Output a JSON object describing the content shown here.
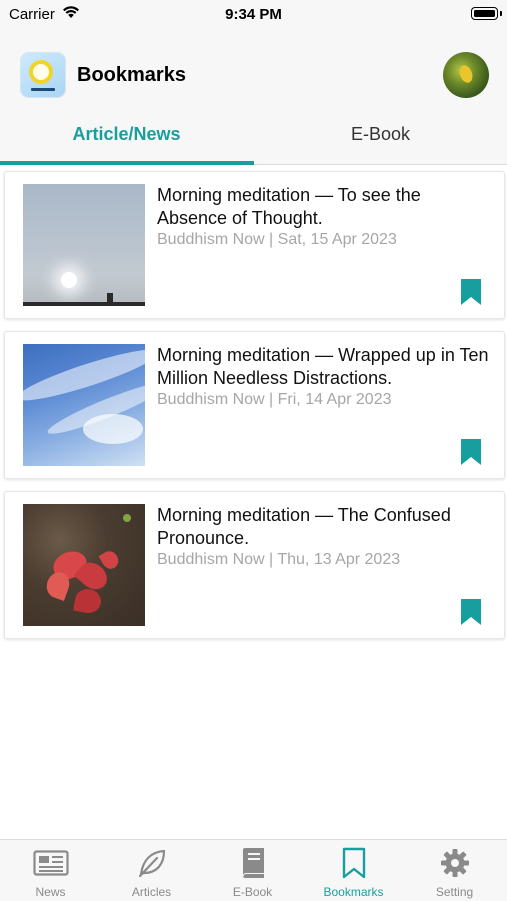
{
  "status_bar": {
    "carrier": "Carrier",
    "time": "9:34 PM"
  },
  "header": {
    "title": "Bookmarks"
  },
  "top_tabs": [
    {
      "label": "Article/News",
      "active": true
    },
    {
      "label": "E-Book",
      "active": false
    }
  ],
  "articles": [
    {
      "title": "Morning meditation — To see the Absence of Thought.",
      "meta": "Buddhism Now | Sat, 15 Apr 2023",
      "thumbnail": "hazy-sky-with-sun",
      "bookmarked": true
    },
    {
      "title": "Morning meditation — Wrapped up in Ten Million Needless Distractions.",
      "meta": "Buddhism Now | Fri, 14 Apr 2023",
      "thumbnail": "blue-sky-with-clouds",
      "bookmarked": true
    },
    {
      "title": "Morning meditation — The Confused Pronounce.",
      "meta": "Buddhism Now | Thu, 13 Apr 2023",
      "thumbnail": "red-plant-in-soil",
      "bookmarked": true
    }
  ],
  "bottom_tabs": [
    {
      "label": "News",
      "icon": "newspaper-icon",
      "active": false
    },
    {
      "label": "Articles",
      "icon": "leaf-icon",
      "active": false
    },
    {
      "label": "E-Book",
      "icon": "book-icon",
      "active": false
    },
    {
      "label": "Bookmarks",
      "icon": "bookmark-icon",
      "active": true
    },
    {
      "label": "Setting",
      "icon": "gear-icon",
      "active": false
    }
  ],
  "colors": {
    "accent": "#199ea0",
    "inactive": "#8a8a8a",
    "meta_text": "#a6a6a6",
    "bar_background": "#f7f7f7"
  }
}
